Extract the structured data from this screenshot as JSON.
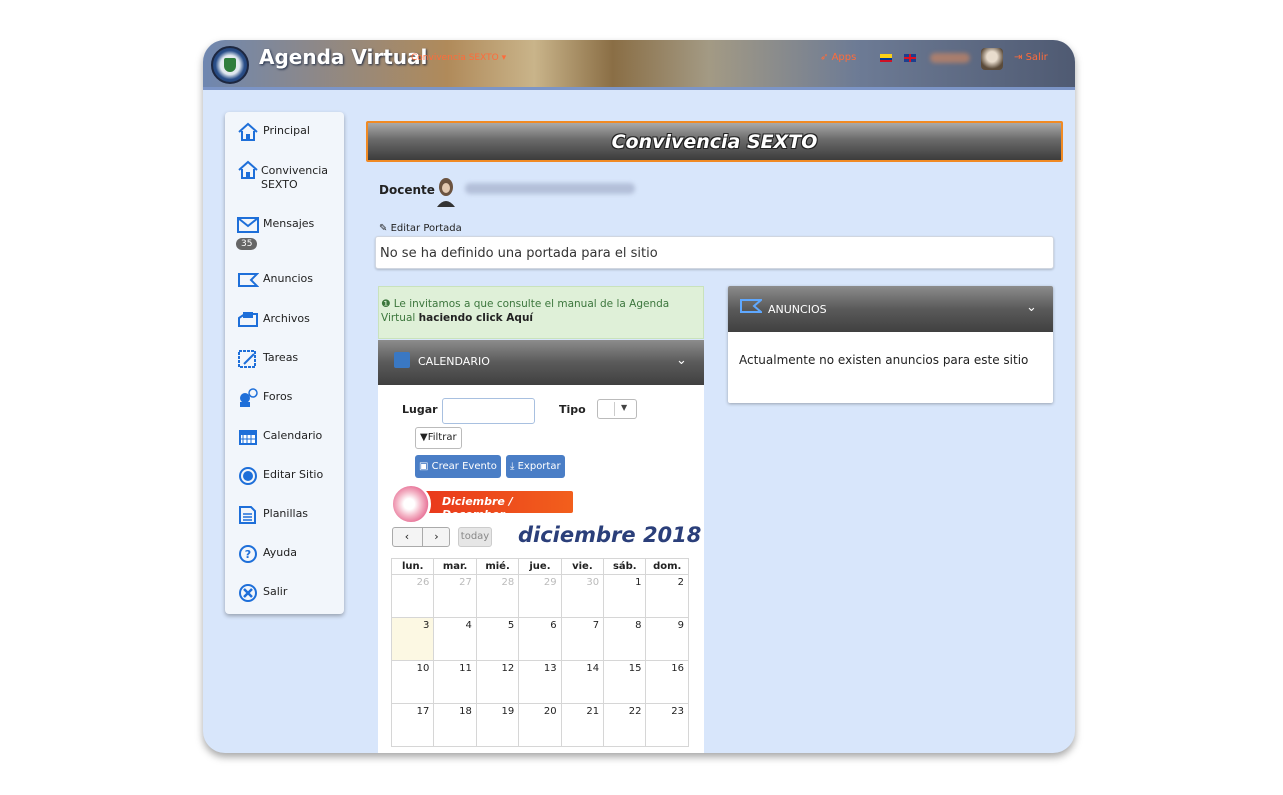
{
  "header": {
    "app_title": "Agenda Virtual",
    "site_menu": "Convivencia SEXTO ▾",
    "apps_label": "Apps",
    "logout_label": "Salir"
  },
  "sidebar": {
    "items": [
      {
        "label": "Principal"
      },
      {
        "label": "Convivencia SEXTO"
      },
      {
        "label": "Mensajes",
        "badge": "35"
      },
      {
        "label": "Anuncios"
      },
      {
        "label": "Archivos"
      },
      {
        "label": "Tareas"
      },
      {
        "label": "Foros"
      },
      {
        "label": "Calendario"
      },
      {
        "label": "Editar Sitio"
      },
      {
        "label": "Planillas"
      },
      {
        "label": "Ayuda"
      },
      {
        "label": "Salir"
      }
    ],
    "accent": "#1e6fd9"
  },
  "main": {
    "title": "Convivencia SEXTO",
    "docente_label": "Docente",
    "edit_portada": "Editar Portada",
    "portada_text": "No se ha definido una portada para el sitio",
    "info_text": "Le invitamos a que consulte el manual de la Agenda Virtual",
    "info_link": "haciendo click Aquí"
  },
  "calendar": {
    "panel_title": "CALENDARIO",
    "lugar_label": "Lugar",
    "lugar_value": "",
    "tipo_label": "Tipo",
    "filter_label": "Filtrar",
    "create_label": "Crear Evento",
    "export_label": "Exportar",
    "month_banner": "Diciembre / December",
    "today_label": "today",
    "title": "diciembre 2018",
    "weekdays": [
      "lun.",
      "mar.",
      "mié.",
      "jue.",
      "vie.",
      "sáb.",
      "dom."
    ],
    "weeks": [
      [
        "26",
        "27",
        "28",
        "29",
        "30",
        "1",
        "2"
      ],
      [
        "3",
        "4",
        "5",
        "6",
        "7",
        "8",
        "9"
      ],
      [
        "10",
        "11",
        "12",
        "13",
        "14",
        "15",
        "16"
      ],
      [
        "17",
        "18",
        "19",
        "20",
        "21",
        "22",
        "23"
      ]
    ]
  },
  "announcements": {
    "panel_title": "ANUNCIOS",
    "empty_text": "Actualmente no existen anuncios para este sitio"
  },
  "colors": {
    "frame_bg": "#d8e6fb",
    "banner_border": "#f08a24",
    "button_blue": "#4a7ec6",
    "link_orange": "#ff6b3a"
  }
}
